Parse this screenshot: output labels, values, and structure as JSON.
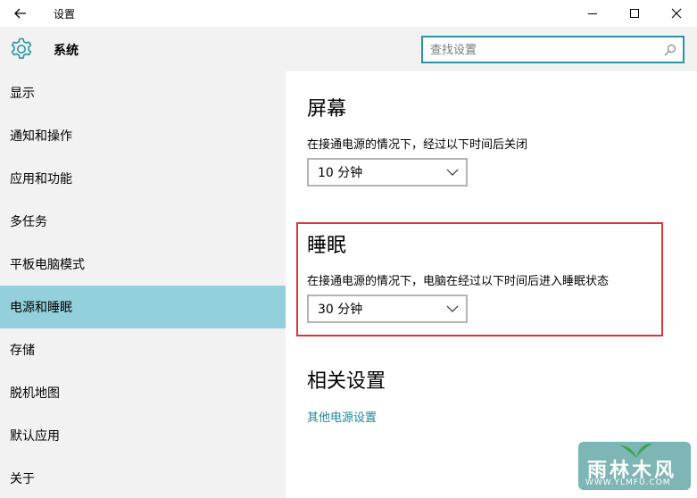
{
  "window": {
    "title": "设置"
  },
  "header": {
    "title": "系统"
  },
  "search": {
    "placeholder": "查找设置"
  },
  "sidebar": {
    "items": [
      {
        "label": "显示",
        "active": false
      },
      {
        "label": "通知和操作",
        "active": false
      },
      {
        "label": "应用和功能",
        "active": false
      },
      {
        "label": "多任务",
        "active": false
      },
      {
        "label": "平板电脑模式",
        "active": false
      },
      {
        "label": "电源和睡眠",
        "active": true
      },
      {
        "label": "存储",
        "active": false
      },
      {
        "label": "脱机地图",
        "active": false
      },
      {
        "label": "默认应用",
        "active": false
      },
      {
        "label": "关于",
        "active": false
      }
    ]
  },
  "screen": {
    "title": "屏幕",
    "desc": "在接通电源的情况下，经过以下时间后关闭",
    "value": "10 分钟"
  },
  "sleep": {
    "title": "睡眠",
    "desc": "在接通电源的情况下，电脑在经过以下时间后进入睡眠状态",
    "value": "30 分钟"
  },
  "related": {
    "title": "相关设置",
    "link": "其他电源设置"
  },
  "watermark": {
    "text": "雨林木风",
    "url": "WWW.YLMFU.COM"
  },
  "colors": {
    "accent": "#2a94a6",
    "active_bg": "#94cfdc",
    "link": "#1a8a9d",
    "highlight": "#d9363e",
    "sidebar_bg": "#f2f2f2"
  }
}
